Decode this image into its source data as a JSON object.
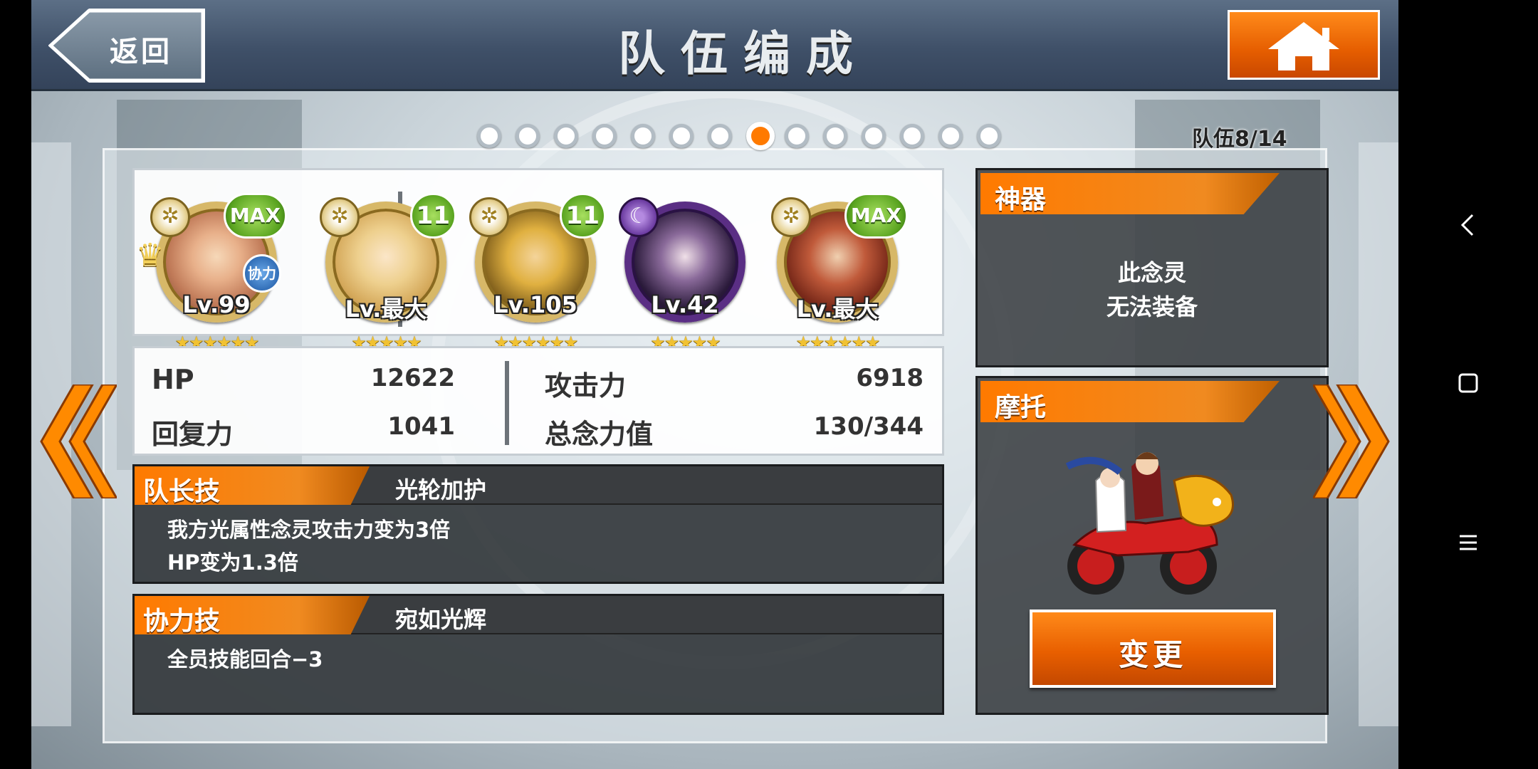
{
  "header": {
    "back_label": "返回",
    "title": "队伍编成"
  },
  "pager": {
    "total_dots": 14,
    "active_index": 7,
    "counter": "队伍8/14"
  },
  "team": {
    "members": [
      {
        "level": "Lv.99",
        "badge": "MAX",
        "element": "light",
        "leader": true,
        "assist": "协力",
        "stars": 6
      },
      {
        "level": "Lv.最大",
        "badge": "11",
        "element": "light",
        "leader": false,
        "stars": 5
      },
      {
        "level": "Lv.105",
        "badge": "11",
        "element": "light",
        "leader": false,
        "stars": 6
      },
      {
        "level": "Lv.42",
        "badge": "",
        "element": "dark",
        "leader": false,
        "stars": 5
      },
      {
        "level": "Lv.最大",
        "badge": "MAX",
        "element": "light",
        "leader": false,
        "stars": 6
      }
    ]
  },
  "stats": {
    "hp_label": "HP",
    "hp_value": "12622",
    "recovery_label": "回复力",
    "recovery_value": "1041",
    "attack_label": "攻击力",
    "attack_value": "6918",
    "total_label": "总念力值",
    "total_value": "130/344"
  },
  "leader_skill": {
    "tab": "队长技",
    "name": "光轮加护",
    "desc_line1": "我方光属性念灵攻击力变为3倍",
    "desc_line2": "HP变为1.3倍"
  },
  "assist_skill": {
    "tab": "协力技",
    "name": "宛如光辉",
    "desc_line1": "全员技能回合−3"
  },
  "artifact": {
    "title": "神器",
    "msg_line1": "此念灵",
    "msg_line2": "无法装备"
  },
  "motorcycle": {
    "title": "摩托",
    "change_label": "变更"
  },
  "colors": {
    "accent_orange": "#ff7a00",
    "level_green": "#5aa420",
    "panel_dark": "#2e3236"
  }
}
